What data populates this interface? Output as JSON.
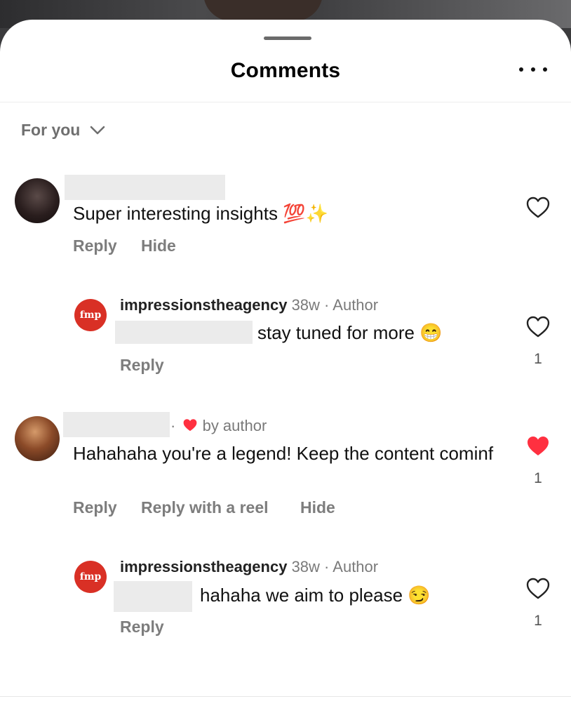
{
  "header": {
    "title": "Comments"
  },
  "filter": {
    "label": "For you"
  },
  "comments": [
    {
      "text": "Super interesting insights 💯✨",
      "actions": [
        "Reply",
        "Hide"
      ],
      "liked": false
    },
    {
      "user": "impressionstheagency",
      "time": "38w",
      "badge": "Author",
      "avatar_text": "fmp",
      "text": "stay tuned for more 😁",
      "actions": [
        "Reply"
      ],
      "likes": "1",
      "liked": false
    },
    {
      "byline": "by author",
      "text": "Hahahaha you're a legend! Keep the content cominf",
      "actions": [
        "Reply",
        "Reply with a reel",
        "Hide"
      ],
      "likes": "1",
      "liked": true
    },
    {
      "user": "impressionstheagency",
      "time": "38w",
      "badge": "Author",
      "avatar_text": "fmp",
      "text": "hahaha we aim to please 😏",
      "actions": [
        "Reply"
      ],
      "likes": "1",
      "liked": false
    }
  ],
  "colors": {
    "heart_liked": "#ff3040",
    "brand": "#d93025"
  }
}
